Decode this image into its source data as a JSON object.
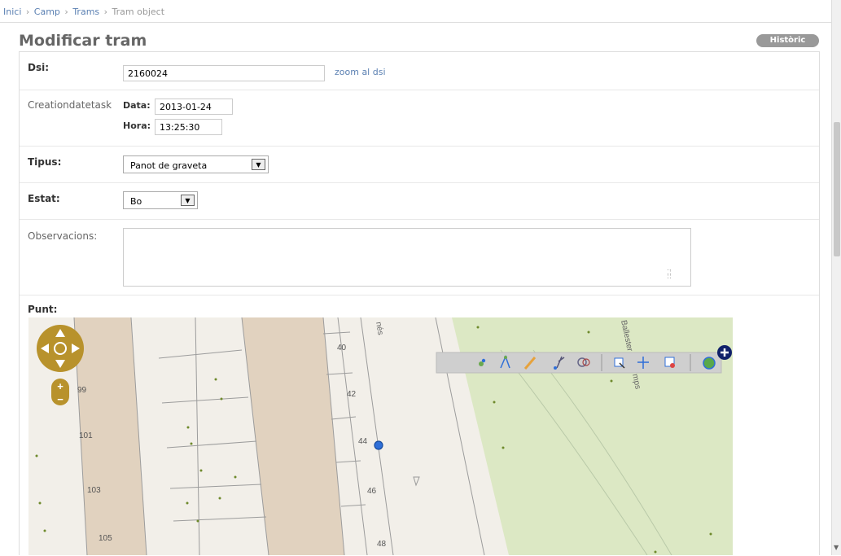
{
  "breadcrumbs": {
    "home": "Inici",
    "app": "Camp",
    "model": "Trams",
    "current": "Tram object",
    "separator": "›"
  },
  "page": {
    "title": "Modificar tram",
    "history_label": "Històric"
  },
  "fields": {
    "dsi": {
      "label": "Dsi:",
      "value": "2160024",
      "link": "zoom al dsi"
    },
    "creation": {
      "label": "Creationdatetask",
      "date_label": "Data:",
      "date_value": "2013-01-24",
      "time_label": "Hora:",
      "time_value": "13:25:30"
    },
    "tipus": {
      "label": "Tipus:",
      "value": "Panot de graveta"
    },
    "estat": {
      "label": "Estat:",
      "value": "Bo"
    },
    "observacions": {
      "label": "Observacions:",
      "value": ""
    },
    "punt": {
      "label": "Punt:"
    }
  },
  "map": {
    "street_labels": [
      "nés",
      "Ballester",
      "mps"
    ],
    "house_numbers": [
      "99",
      "101",
      "103",
      "105",
      "40",
      "42",
      "44",
      "46",
      "48"
    ],
    "icons": [
      "pan-zoom-control",
      "zoom-in-icon",
      "zoom-out-icon",
      "node-icon",
      "line-icon",
      "pencil-icon",
      "scissors-icon",
      "merge-icon",
      "select-box-icon",
      "move-icon",
      "delete-icon",
      "globe-icon",
      "add-layer-icon",
      "point-marker"
    ],
    "colors": {
      "building": "#e1d2bf",
      "park": "#dce8c4",
      "accent": "#b8922c",
      "marker": "#2f6fd8",
      "toolbar": "#cfcfcf"
    }
  }
}
